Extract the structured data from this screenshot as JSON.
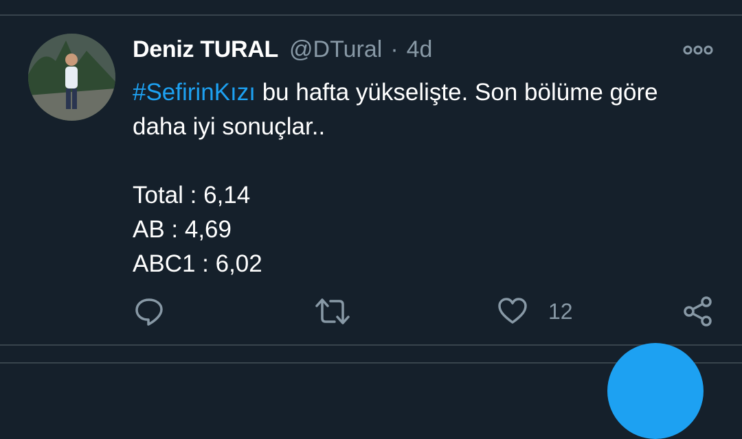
{
  "tweet": {
    "author_name": "Deniz TURAL",
    "handle": "@DTural",
    "separator": "·",
    "time": "4d",
    "hashtag": "#SefirinKızı",
    "line1_rest": " bu hafta yükselişte. Son bölüme göre",
    "line2": "daha iyi sonuçlar..",
    "stats": [
      "Total : 6,14",
      "AB : 4,69",
      "ABC1 : 6,02"
    ],
    "like_count": "12"
  },
  "icons": {
    "more": "more-icon",
    "reply": "reply-icon",
    "retweet": "retweet-icon",
    "like": "heart-icon",
    "share": "share-icon"
  },
  "colors": {
    "background": "#15202b",
    "secondary_text": "#8899a6",
    "accent": "#1da1f2",
    "divider": "#38444d"
  }
}
